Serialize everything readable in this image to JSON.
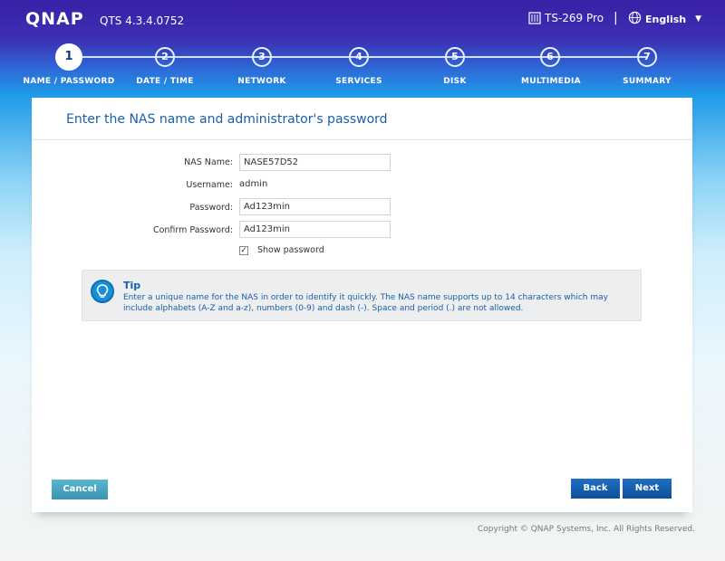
{
  "header": {
    "logo": "QNAP",
    "version": "QTS 4.3.4.0752",
    "model": "TS-269 Pro",
    "separator": "|",
    "language": "English",
    "model_icon": "server-icon",
    "language_icon": "globe-icon",
    "dropdown_icon": "chevron-down-icon"
  },
  "steps": [
    {
      "number": "1",
      "label": "NAME / PASSWORD",
      "active": true
    },
    {
      "number": "2",
      "label": "DATE / TIME",
      "active": false
    },
    {
      "number": "3",
      "label": "NETWORK",
      "active": false
    },
    {
      "number": "4",
      "label": "SERVICES",
      "active": false
    },
    {
      "number": "5",
      "label": "DISK",
      "active": false
    },
    {
      "number": "6",
      "label": "MULTIMEDIA",
      "active": false
    },
    {
      "number": "7",
      "label": "SUMMARY",
      "active": false
    }
  ],
  "panel": {
    "title": "Enter the NAS name and administrator's password"
  },
  "form": {
    "nas_name_label": "NAS Name:",
    "nas_name_value": "NASE57D52",
    "username_label": "Username:",
    "username_value": "admin",
    "password_label": "Password:",
    "password_value": "Ad123min",
    "confirm_label": "Confirm Password:",
    "confirm_value": "Ad123min",
    "show_password_label": "Show password",
    "show_password_checked": true,
    "checkmark": "✓"
  },
  "tip": {
    "icon": "lightbulb-icon",
    "title": "Tip",
    "text": "Enter a unique name for the NAS in order to identify it quickly. The NAS name supports up to 14 characters which may include alphabets (A-Z and a-z), numbers (0-9) and dash (-). Space and period (.) are not allowed."
  },
  "buttons": {
    "cancel": "Cancel",
    "back": "Back",
    "next": "Next"
  },
  "footer": {
    "copyright": "Copyright © QNAP Systems, Inc. All Rights Reserved."
  },
  "colors": {
    "accent": "#1b5fa8",
    "button_primary": "#0d4f99",
    "button_cancel": "#3a93ad"
  }
}
